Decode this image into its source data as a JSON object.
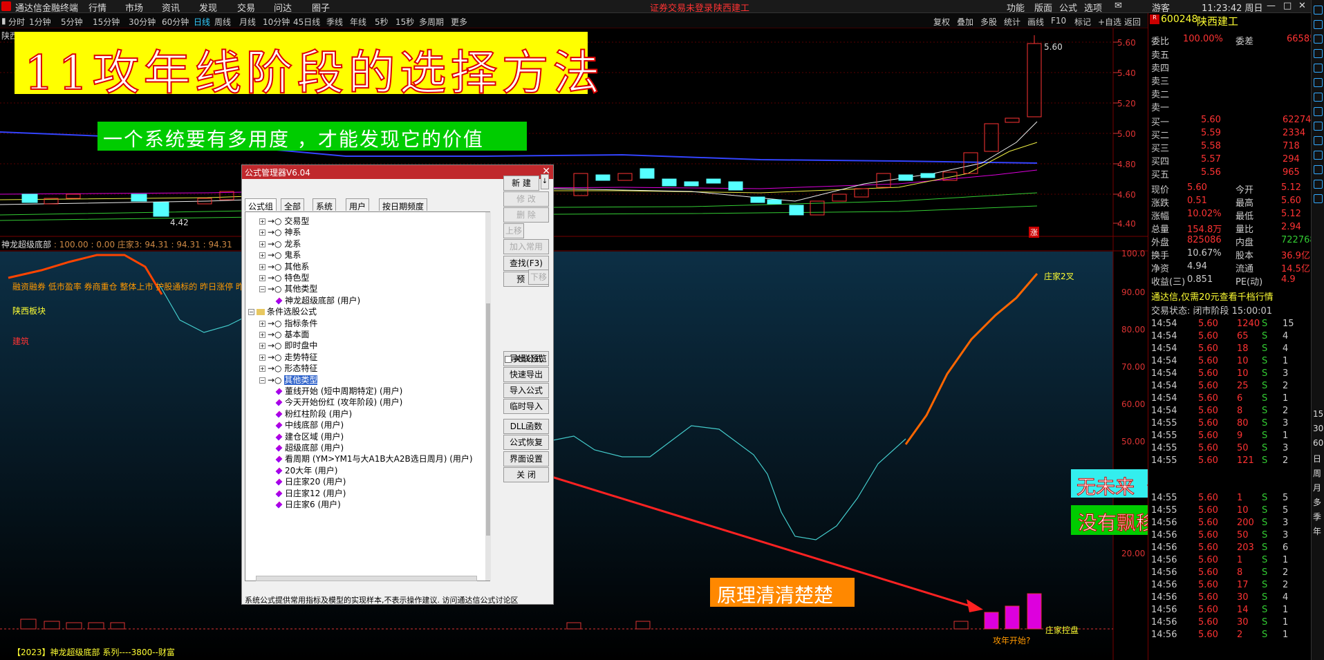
{
  "menubar": {
    "app": "通达信金融终端",
    "items": [
      "行情",
      "市场",
      "资讯",
      "发现",
      "交易",
      "问达",
      "圈子"
    ],
    "notice": "证券交易未登录",
    "stock": "陕西建工",
    "right": [
      "功能",
      "版面",
      "公式",
      "选项"
    ],
    "user": "游客",
    "time": "11:23:42 周日"
  },
  "periods": [
    "分时",
    "1分钟",
    "5分钟",
    "15分钟",
    "30分钟",
    "60分钟",
    "日线",
    "周线",
    "月线",
    "10分钟",
    "45日线",
    "季线",
    "年线",
    "5秒",
    "15秒",
    "多周期",
    "更多"
  ],
  "toolbar": [
    "复权",
    "叠加",
    "多股",
    "统计",
    "画线",
    "F10",
    "标记",
    "+自选",
    "返回"
  ],
  "chart": {
    "corner": "陕西",
    "price_labels": [
      "5.60",
      "5.40",
      "5.20",
      "5.00",
      "4.80",
      "4.60",
      "4.40"
    ],
    "max_label": "5.60",
    "min_label": "4.42",
    "zhang": "涨"
  },
  "indicator": {
    "header": "神龙超级底部",
    "vals": ": 100.00 : 0.00  庄家3: 94.31 : 94.31 : 94.31",
    "labels": [
      "融资融券 低市盈率 券商重仓 整体上市 护股通标的 昨日涨停 昨日"
    ],
    "board": "陕西板块",
    "sector": "建筑",
    "yaxis": [
      "100.0",
      "90.00",
      "80.00",
      "70.00",
      "60.00",
      "50.00",
      "20.00"
    ],
    "zj2": "庄家2叉",
    "zjkp": "庄家控盘",
    "gn": "攻年开始?",
    "footer": "【2023】神龙超级底部 系列----3800--财富"
  },
  "banners": {
    "title": "11攻年线阶段的选择方法",
    "subtitle": "一个系统要有多用度 ，才能发现它的价值",
    "r1": "无未来  信号有就是有",
    "r2": "没有飘移情况",
    "bottom": "原理清清楚楚"
  },
  "dialog": {
    "title": "公式管理器V6.04",
    "tabs": [
      "公式组",
      "全部",
      "系统",
      "用户",
      "按日期频度"
    ],
    "tree": [
      {
        "t": "交易型",
        "lv": 1,
        "k": "pm"
      },
      {
        "t": "神系",
        "lv": 1,
        "k": "pm"
      },
      {
        "t": "龙系",
        "lv": 1,
        "k": "pm"
      },
      {
        "t": "鬼系",
        "lv": 1,
        "k": "pm"
      },
      {
        "t": "其他系",
        "lv": 1,
        "k": "pm"
      },
      {
        "t": "特色型",
        "lv": 1,
        "k": "pm"
      },
      {
        "t": "其他类型",
        "lv": 1,
        "k": "mm"
      },
      {
        "t": "神龙超级底部 (用户)",
        "lv": 2,
        "k": "gem"
      },
      {
        "t": "条件选股公式",
        "lv": 0,
        "k": "folder"
      },
      {
        "t": "指标条件",
        "lv": 1,
        "k": "pm"
      },
      {
        "t": "基本面",
        "lv": 1,
        "k": "pm"
      },
      {
        "t": "即时盘中",
        "lv": 1,
        "k": "pm"
      },
      {
        "t": "走势特征",
        "lv": 1,
        "k": "pm"
      },
      {
        "t": "形态特征",
        "lv": 1,
        "k": "pm"
      },
      {
        "t": "其他类型",
        "lv": 1,
        "k": "mm",
        "sel": true
      },
      {
        "t": "董线开始 (短中周期特定) (用户)",
        "lv": 2,
        "k": "gem"
      },
      {
        "t": "今天开始份红 (攻年阶段) (用户)",
        "lv": 2,
        "k": "gem"
      },
      {
        "t": "粉红柱阶段 (用户)",
        "lv": 2,
        "k": "gem"
      },
      {
        "t": "中线底部 (用户)",
        "lv": 2,
        "k": "gem"
      },
      {
        "t": "建仓区域 (用户)",
        "lv": 2,
        "k": "gem"
      },
      {
        "t": "超级底部 (用户)",
        "lv": 2,
        "k": "gem"
      },
      {
        "t": "看周期 (YM>YM1与大A1B大A2B选日周月) (用户)",
        "lv": 2,
        "k": "gem"
      },
      {
        "t": "20大年 (用户)",
        "lv": 2,
        "k": "gem"
      },
      {
        "t": "日庄家20 (用户)",
        "lv": 2,
        "k": "gem"
      },
      {
        "t": "日庄家12 (用户)",
        "lv": 2,
        "k": "gem"
      },
      {
        "t": "日庄家6 (用户)",
        "lv": 2,
        "k": "gem"
      }
    ],
    "buttons": [
      {
        "l": "新 建",
        "d": false
      },
      {
        "l": "修 改",
        "d": true
      },
      {
        "l": "删 除",
        "d": true
      },
      {
        "l": "上移",
        "d": true
      },
      {
        "l": "加入常用",
        "d": true
      },
      {
        "l": "查找(F3)",
        "d": false
      },
      {
        "l": "预 览",
        "d": false
      },
      {
        "l": "导出公式",
        "d": false
      },
      {
        "l": "快速导出",
        "d": false
      },
      {
        "l": "导入公式",
        "d": false
      },
      {
        "l": "临时导入",
        "d": false
      },
      {
        "l": "DLL函数",
        "d": false
      },
      {
        "l": "公式恢复",
        "d": false
      },
      {
        "l": "界面设置",
        "d": false
      },
      {
        "l": "关 闭",
        "d": false
      }
    ],
    "movedown": "下移",
    "preview_check": "关联预览",
    "footer": "系统公式提供常用指标及模型的实现样本,不表示操作建议.    访问通达信公式讨论区"
  },
  "right": {
    "code": "600248",
    "name": "陕西建工",
    "weibi": "委比",
    "weibi_v": "100.00%",
    "weicha": "委差",
    "weicha_v": "66585",
    "sells": [
      "卖五",
      "卖四",
      "卖三",
      "卖二",
      "卖一"
    ],
    "buys": [
      {
        "l": "买一",
        "p": "5.60",
        "v": "62274"
      },
      {
        "l": "买二",
        "p": "5.59",
        "v": "2334"
      },
      {
        "l": "买三",
        "p": "5.58",
        "v": "718"
      },
      {
        "l": "买四",
        "p": "5.57",
        "v": "294"
      },
      {
        "l": "买五",
        "p": "5.56",
        "v": "965"
      }
    ],
    "quote": [
      [
        "现价",
        "5.60",
        "今开",
        "5.12"
      ],
      [
        "涨跌",
        "0.51",
        "最高",
        "5.60"
      ],
      [
        "涨幅",
        "10.02%",
        "最低",
        "5.12"
      ],
      [
        "总量",
        "154.8万",
        "量比",
        "2.94"
      ],
      [
        "外盘",
        "825086",
        "内盘",
        "722768"
      ],
      [
        "换手",
        "10.67%",
        "股本",
        "36.9亿"
      ],
      [
        "净资",
        "4.94",
        "流通",
        "14.5亿"
      ],
      [
        "收益(三)",
        "0.851",
        "PE(动)",
        "4.9"
      ]
    ],
    "ad": "通达信,仅需20元查看千档行情",
    "status": "交易状态: 闭市阶段 15:00:01",
    "ticks": [
      [
        "14:54",
        "5.60",
        "1240",
        "S",
        "15"
      ],
      [
        "14:54",
        "5.60",
        "65",
        "S",
        "4"
      ],
      [
        "14:54",
        "5.60",
        "18",
        "S",
        "4"
      ],
      [
        "14:54",
        "5.60",
        "10",
        "S",
        "1"
      ],
      [
        "14:54",
        "5.60",
        "10",
        "S",
        "3"
      ],
      [
        "14:54",
        "5.60",
        "25",
        "S",
        "2"
      ],
      [
        "14:54",
        "5.60",
        "6",
        "S",
        "1"
      ],
      [
        "14:54",
        "5.60",
        "8",
        "S",
        "2"
      ],
      [
        "14:55",
        "5.60",
        "80",
        "S",
        "3"
      ],
      [
        "14:55",
        "5.60",
        "9",
        "S",
        "1"
      ],
      [
        "14:55",
        "5.60",
        "50",
        "S",
        "3"
      ],
      [
        "14:55",
        "5.60",
        "121",
        "S",
        "2"
      ],
      [
        "",
        "",
        "",
        "",
        ""
      ],
      [
        "",
        "",
        "",
        "",
        ""
      ],
      [
        "14:55",
        "5.60",
        "1",
        "S",
        "5"
      ],
      [
        "14:55",
        "5.60",
        "10",
        "S",
        "5"
      ],
      [
        "14:56",
        "5.60",
        "200",
        "S",
        "3"
      ],
      [
        "14:56",
        "5.60",
        "50",
        "S",
        "3"
      ],
      [
        "14:56",
        "5.60",
        "203",
        "S",
        "6"
      ],
      [
        "14:56",
        "5.60",
        "1",
        "S",
        "1"
      ],
      [
        "14:56",
        "5.60",
        "8",
        "S",
        "2"
      ],
      [
        "14:56",
        "5.60",
        "17",
        "S",
        "2"
      ],
      [
        "14:56",
        "5.60",
        "30",
        "S",
        "4"
      ],
      [
        "14:56",
        "5.60",
        "14",
        "S",
        "1"
      ],
      [
        "14:56",
        "5.60",
        "30",
        "S",
        "1"
      ],
      [
        "14:56",
        "5.60",
        "2",
        "S",
        "1"
      ]
    ]
  },
  "sideicons": [
    "15",
    "30",
    "60",
    "日",
    "周",
    "月",
    "多",
    "季",
    "年"
  ],
  "colors": {
    "up": "#ff3b3b",
    "cyan": "#54ffff",
    "yellow": "#ffff00"
  }
}
